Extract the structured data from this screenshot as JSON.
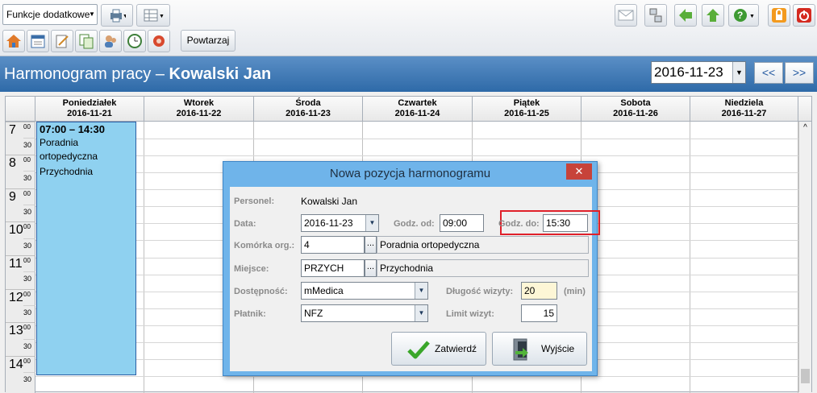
{
  "toolbar": {
    "functions_combo": "Funkcje dodatkowe",
    "repeat_button": "Powtarzaj"
  },
  "header": {
    "title_prefix": "Harmonogram pracy – ",
    "title_name": "Kowalski Jan",
    "date": "2016-11-23",
    "prev_label": "<<",
    "next_label": ">>"
  },
  "calendar": {
    "days": [
      {
        "name": "Poniedziałek",
        "date": "2016-11-21"
      },
      {
        "name": "Wtorek",
        "date": "2016-11-22"
      },
      {
        "name": "Środa",
        "date": "2016-11-23"
      },
      {
        "name": "Czwartek",
        "date": "2016-11-24"
      },
      {
        "name": "Piątek",
        "date": "2016-11-25"
      },
      {
        "name": "Sobota",
        "date": "2016-11-26"
      },
      {
        "name": "Niedziela",
        "date": "2016-11-27"
      }
    ],
    "hours": [
      "7",
      "8",
      "9",
      "10",
      "11",
      "12",
      "13",
      "14"
    ],
    "minute_top": "00",
    "minute_half": "30",
    "event": {
      "time": "07:00 – 14:30",
      "line1": "Poradnia",
      "line2": "ortopedyczna",
      "line3": "Przychodnia"
    }
  },
  "dialog": {
    "title": "Nowa pozycja harmonogramu",
    "close": "✕",
    "personel_label": "Personel:",
    "personel_value": "Kowalski Jan",
    "data_label": "Data:",
    "data_value": "2016-11-23",
    "godz_od_label": "Godz. od:",
    "godz_od_value": "09:00",
    "godz_do_label": "Godz. do:",
    "godz_do_value": "15:30",
    "komorka_label": "Komórka org.:",
    "komorka_code": "4",
    "komorka_name": "Poradnia ortopedyczna",
    "miejsce_label": "Miejsce:",
    "miejsce_code": "PRZYCH",
    "miejsce_name": "Przychodnia",
    "dostepnosc_label": "Dostępność:",
    "dostepnosc_value": "mMedica",
    "platnik_label": "Płatnik:",
    "platnik_value": "NFZ",
    "dlugosc_label": "Długość wizyty:",
    "dlugosc_value": "20",
    "dlugosc_unit": "(min)",
    "limit_label": "Limit wizyt:",
    "limit_value": "15",
    "ellipsis": "...",
    "confirm_label": "Zatwierdź",
    "exit_label": "Wyjście"
  },
  "colors": {
    "title_bar": "#3a76b6",
    "event_fill": "#8fd1f0",
    "highlight": "#e0202a",
    "dialog_frame": "#6fb4ea"
  }
}
